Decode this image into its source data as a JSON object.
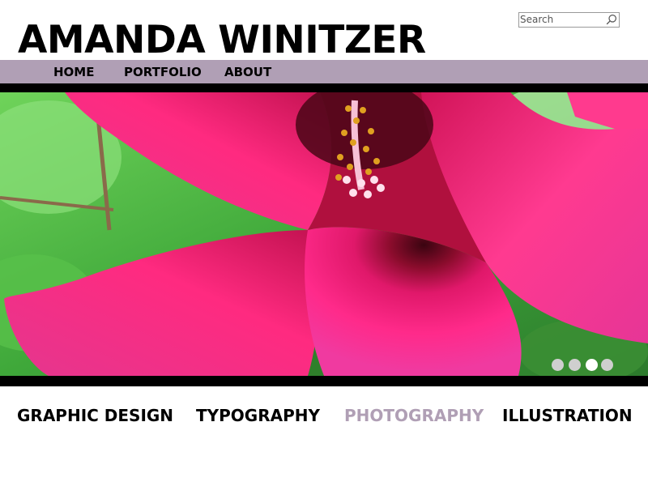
{
  "header": {
    "site_title": "AMANDA WINITZER",
    "search": {
      "placeholder": "Search",
      "value": "",
      "icon": "search-icon"
    }
  },
  "nav": {
    "items": [
      {
        "label": "HOME"
      },
      {
        "label": "PORTFOLIO"
      },
      {
        "label": "ABOUT"
      }
    ]
  },
  "hero": {
    "image": "pink hibiscus flower photograph",
    "slides_total": 4,
    "active_slide": 3
  },
  "categories": {
    "items": [
      {
        "label": "GRAPHIC DESIGN",
        "active": false
      },
      {
        "label": "TYPOGRAPHY",
        "active": false
      },
      {
        "label": "PHOTOGRAPHY",
        "active": true
      },
      {
        "label": "ILLUSTRATION",
        "active": false
      }
    ]
  },
  "colors": {
    "nav_background": "#b09fb5",
    "active_category": "#b09fb5",
    "text": "#000000",
    "bands": "#000000"
  }
}
